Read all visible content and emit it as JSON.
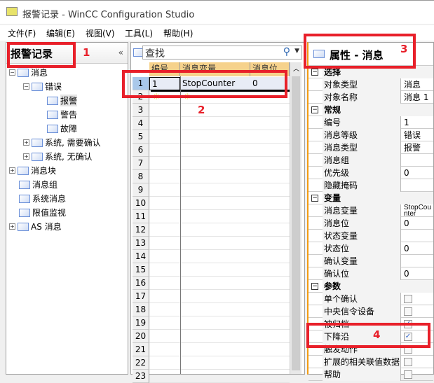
{
  "window": {
    "title": "报警记录 - WinCC Configuration Studio"
  },
  "menu": [
    "文件(F)",
    "编辑(E)",
    "视图(V)",
    "工具(L)",
    "帮助(H)"
  ],
  "left": {
    "title": "报警记录",
    "collapse": "«",
    "tree": [
      {
        "label": "消息",
        "level": 0,
        "exp": "−"
      },
      {
        "label": "错误",
        "level": 1,
        "exp": "−"
      },
      {
        "label": "报警",
        "level": 2,
        "exp": ""
      },
      {
        "label": "警告",
        "level": 2,
        "exp": ""
      },
      {
        "label": "故障",
        "level": 2,
        "exp": ""
      },
      {
        "label": "系统, 需要确认",
        "level": 1,
        "exp": "+"
      },
      {
        "label": "系统, 无确认",
        "level": 1,
        "exp": "+"
      },
      {
        "label": "消息块",
        "level": 0,
        "exp": "+"
      },
      {
        "label": "消息组",
        "level": 0,
        "exp": ""
      },
      {
        "label": "系统消息",
        "level": 0,
        "exp": ""
      },
      {
        "label": "限值监视",
        "level": 0,
        "exp": ""
      },
      {
        "label": "AS 消息",
        "level": 0,
        "exp": "+"
      }
    ]
  },
  "grid": {
    "search_placeholder": "查找",
    "columns": [
      "编号",
      "消息变量",
      "消息位"
    ],
    "rows": [
      [
        "1",
        "StopCounter",
        "0"
      ]
    ],
    "new_row_marker": "✳",
    "row_count": 23
  },
  "properties": {
    "title": "属性 - 消息",
    "rows": [
      {
        "section": "选择"
      },
      {
        "k": "对象类型",
        "v": "消息"
      },
      {
        "k": "对象名称",
        "v": "消息 1"
      },
      {
        "section": "常规"
      },
      {
        "k": "编号",
        "v": "1"
      },
      {
        "k": "消息等级",
        "v": "错误"
      },
      {
        "k": "消息类型",
        "v": "报警"
      },
      {
        "k": "消息组",
        "v": ""
      },
      {
        "k": "优先级",
        "v": "0"
      },
      {
        "k": "隐藏掩码",
        "v": ""
      },
      {
        "section": "变量"
      },
      {
        "k": "消息变量",
        "v": "StopCounter"
      },
      {
        "k": "消息位",
        "v": "0"
      },
      {
        "k": "状态变量",
        "v": ""
      },
      {
        "k": "状态位",
        "v": "0"
      },
      {
        "k": "确认变量",
        "v": ""
      },
      {
        "k": "确认位",
        "v": "0"
      },
      {
        "section": "参数"
      },
      {
        "k": "单个确认",
        "cb": false
      },
      {
        "k": "中央信令设备",
        "cb": false
      },
      {
        "k": "被归档",
        "cb": true
      },
      {
        "k": "下降沿",
        "cb": true
      },
      {
        "k": "触发动作",
        "cb": false
      },
      {
        "k": "扩展的相关联值数据",
        "cb": false
      },
      {
        "k": "帮助",
        "cb": false
      }
    ]
  },
  "annotations": [
    "1",
    "2",
    "3",
    "4"
  ],
  "colors": {
    "annotation": "#e8202a",
    "header": "#f6d28c",
    "accent": "#f39c12"
  }
}
